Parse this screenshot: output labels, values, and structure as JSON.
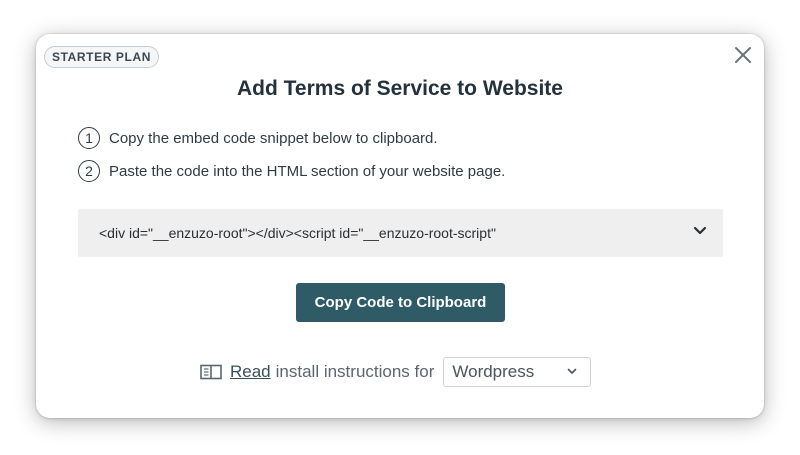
{
  "modal": {
    "badge": "STARTER PLAN",
    "title": "Add Terms of Service to Website",
    "close_icon": "close-icon"
  },
  "steps": [
    {
      "number": "1",
      "text": "Copy the embed code snippet below to clipboard."
    },
    {
      "number": "2",
      "text": "Paste the code into the HTML section of your website page."
    }
  ],
  "code_snippet": {
    "text": "<div id=\"__enzuzo-root\"></div><script id=\"__enzuzo-root-script\"",
    "expand_icon": "chevron-down-icon"
  },
  "copy_button": {
    "label": "Copy Code to Clipboard"
  },
  "install": {
    "icon": "book-open-icon",
    "link_label": "Read",
    "text": "install instructions for",
    "platform_selected": "Wordpress",
    "caret_icon": "chevron-down-icon"
  },
  "colors": {
    "primary_button": "#2e5b66",
    "code_background": "#efefef",
    "text": "#23323c"
  }
}
